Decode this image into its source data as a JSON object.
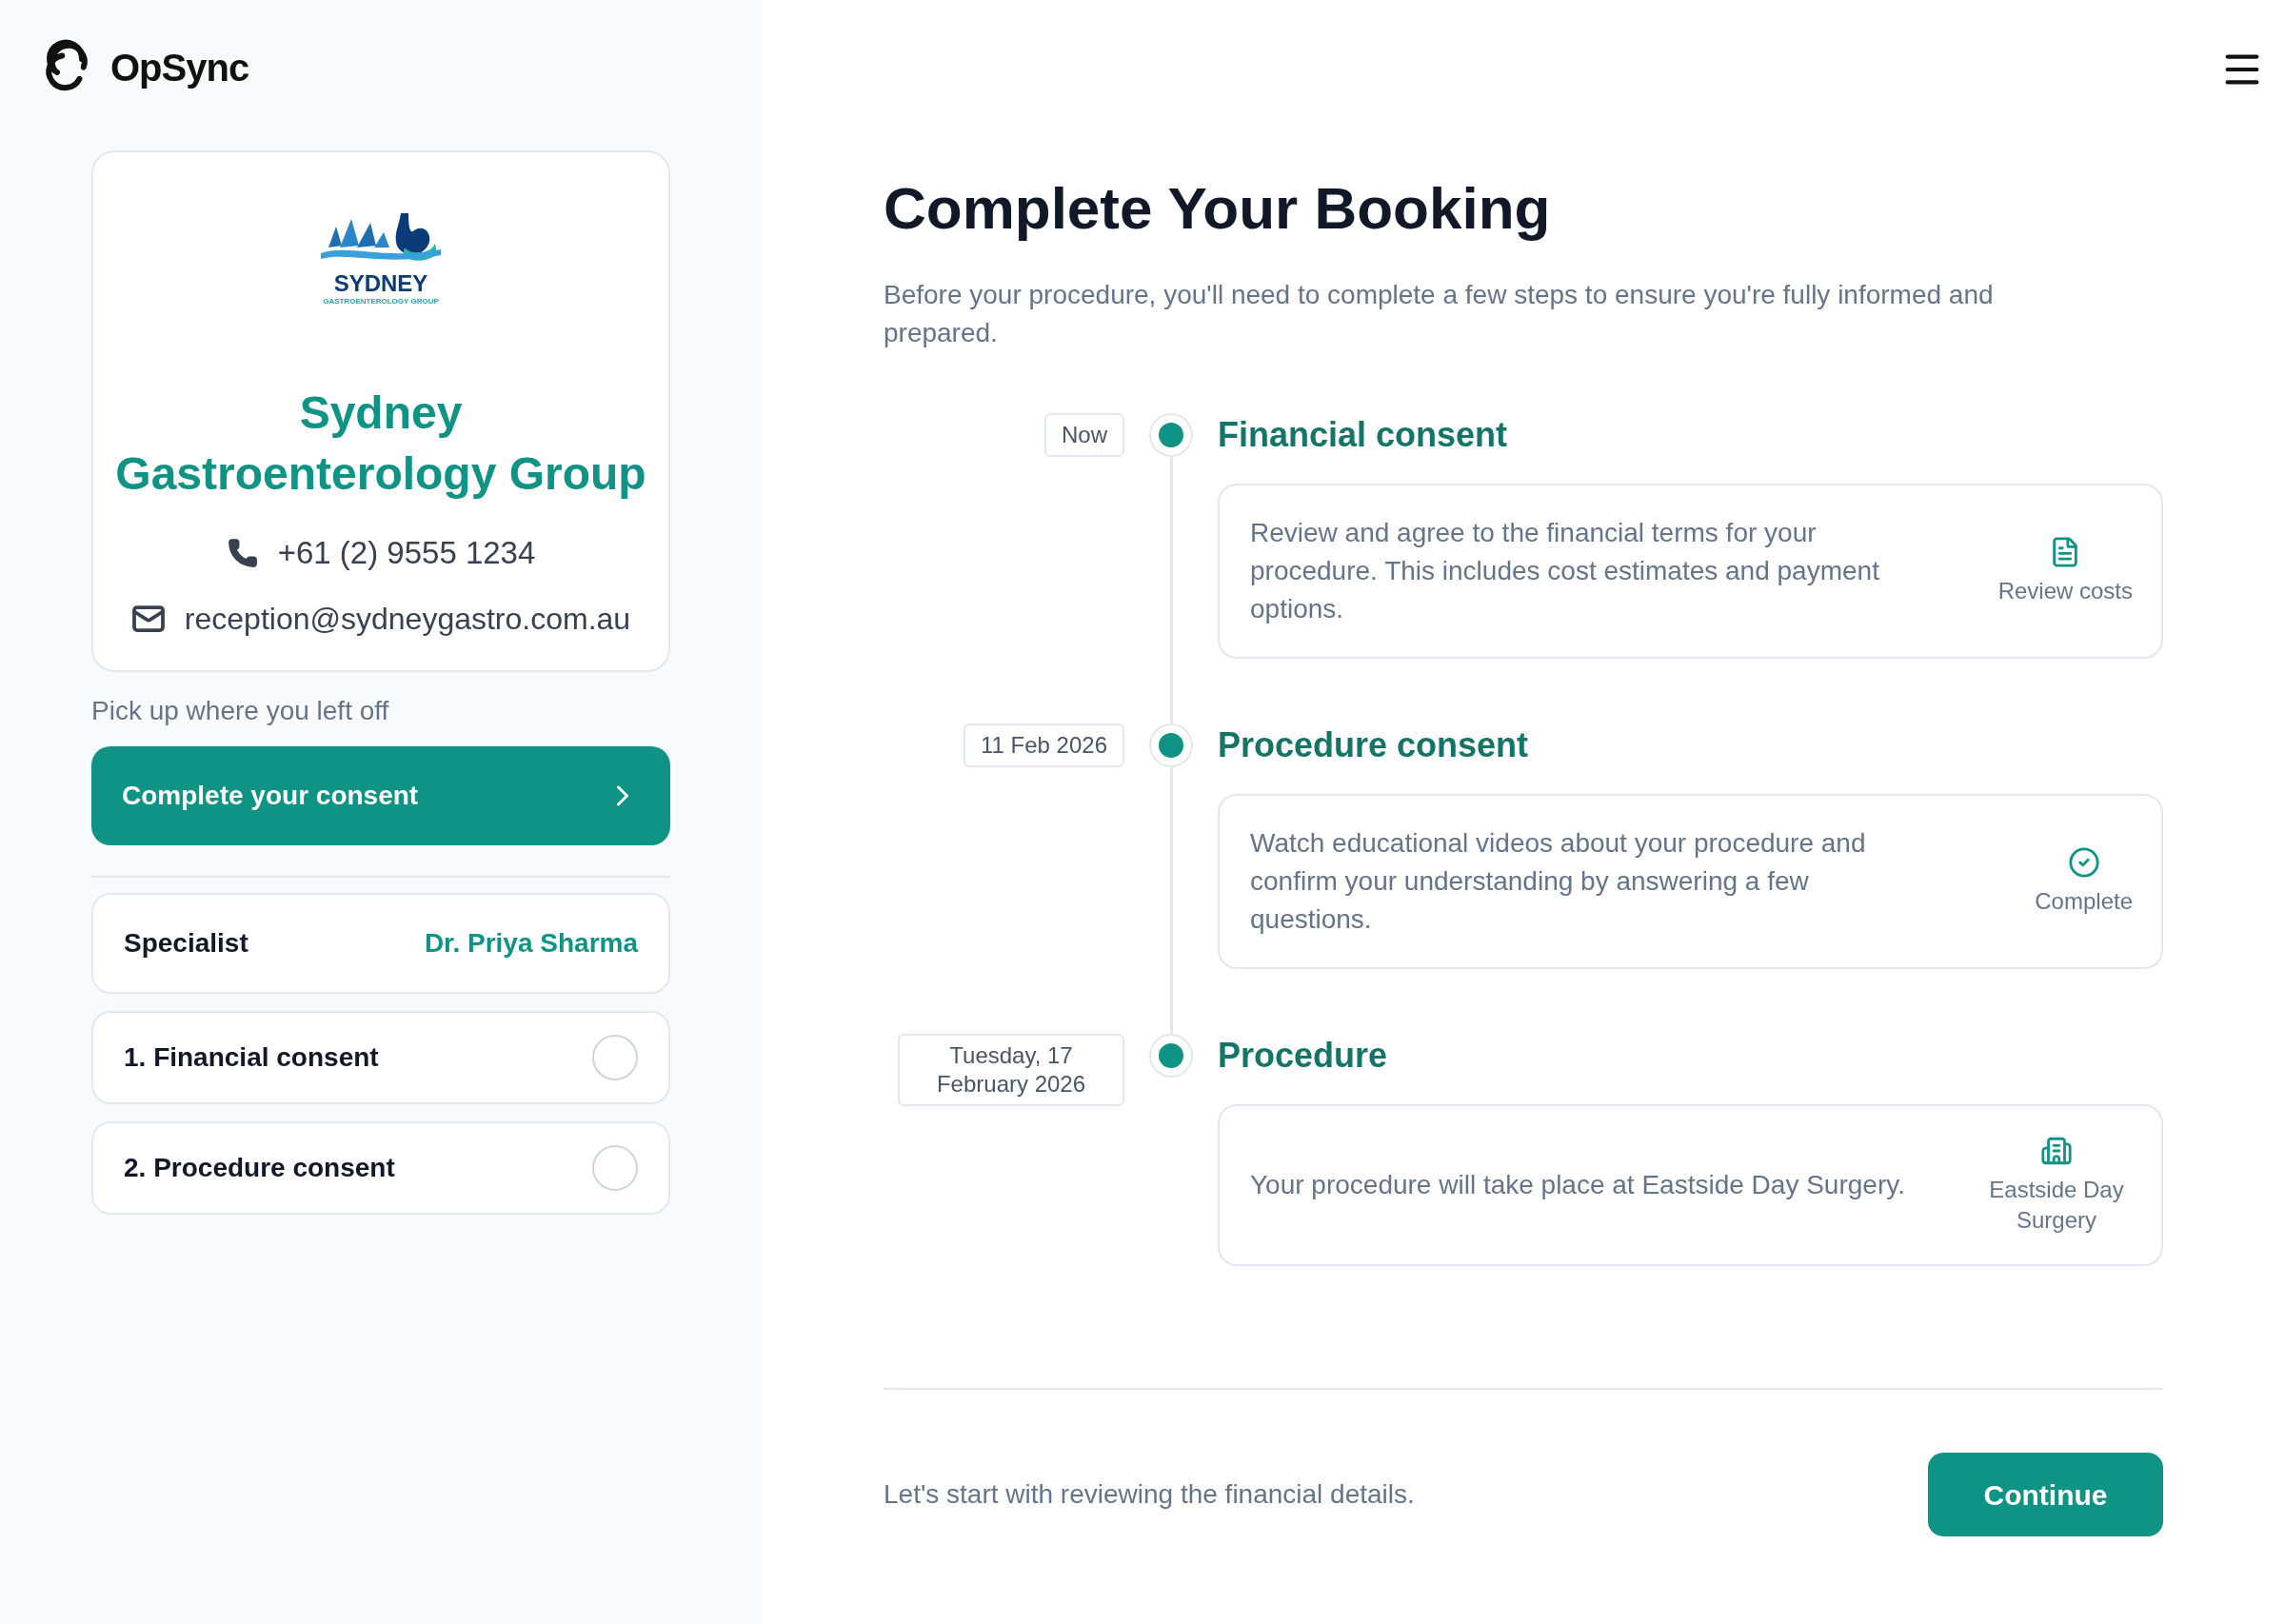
{
  "brand": {
    "name": "OpSync"
  },
  "clinic": {
    "logo": {
      "title": "SYDNEY",
      "subtitle": "GASTROENTEROLOGY GROUP"
    },
    "name": "Sydney Gastroenterology Group",
    "phone": "+61 (2) 9555 1234",
    "email": "reception@sydneygastro.com.au"
  },
  "resume": {
    "label": "Pick up where you left off",
    "button": "Complete your consent"
  },
  "specialist": {
    "label": "Specialist",
    "name": "Dr. Priya Sharma"
  },
  "checklist": [
    {
      "label": "1. Financial consent",
      "checked": false
    },
    {
      "label": "2. Procedure consent",
      "checked": false
    }
  ],
  "main": {
    "title": "Complete Your Booking",
    "intro": "Before your procedure, you'll need to complete a few steps to ensure you're fully informed and prepared."
  },
  "steps": [
    {
      "date": "Now",
      "title": "Financial consent",
      "description": "Review and agree to the financial terms for your procedure. This includes cost estimates and payment options.",
      "kind": "document",
      "action": "Review costs"
    },
    {
      "date": "11 Feb 2026",
      "title": "Procedure consent",
      "description": "Watch educational videos about your procedure and confirm your understanding by answering a few questions.",
      "kind": "check",
      "action": "Complete"
    },
    {
      "date": "Tuesday, 17 February 2026",
      "title": "Procedure",
      "description": "Your procedure will take place at Eastside Day Surgery.",
      "kind": "building",
      "action": "Eastside Day Surgery"
    }
  ],
  "footer": {
    "text": "Let's start with reviewing the financial details.",
    "button": "Continue"
  }
}
